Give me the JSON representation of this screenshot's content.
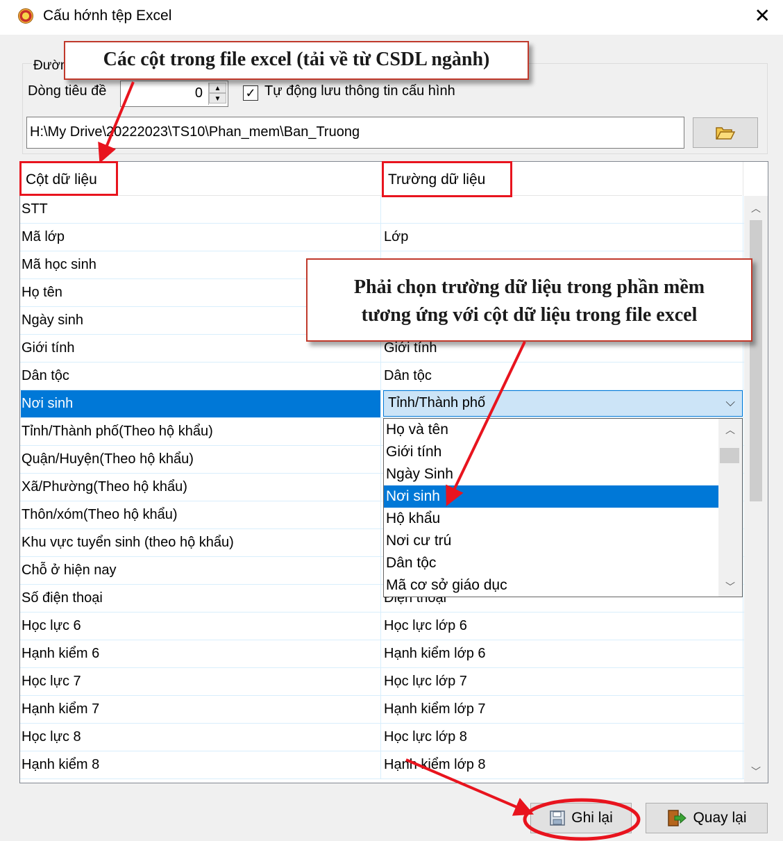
{
  "window": {
    "title": "Cấu hớnh tệp Excel",
    "close_glyph": "✕"
  },
  "config": {
    "path_group_label": "Đường",
    "header_row_label": "Dòng tiêu đề",
    "header_row_value": "0",
    "autosave_label": "Tự động lưu thông tin cấu hình",
    "autosave_checked": true,
    "file_path": "H:\\My Drive\\20222023\\TS10\\Phan_mem\\Ban_Truong"
  },
  "grid": {
    "columns": [
      "Cột dữ liệu",
      "Trường dữ liệu"
    ],
    "rows": [
      {
        "excel": "STT",
        "field": ""
      },
      {
        "excel": "Mã lớp",
        "field": "Lớp"
      },
      {
        "excel": "Mã học sinh",
        "field": ""
      },
      {
        "excel": "Họ tên",
        "field": ""
      },
      {
        "excel": "Ngày sinh",
        "field": ""
      },
      {
        "excel": "Giới tính",
        "field": "Giới tính"
      },
      {
        "excel": "Dân tộc",
        "field": "Dân tộc"
      },
      {
        "excel": "Nơi sinh",
        "field": "Tỉnh/Thành phố"
      },
      {
        "excel": "Tỉnh/Thành phố(Theo hộ khẩu)",
        "field": ""
      },
      {
        "excel": "Quận/Huyện(Theo hộ khẩu)",
        "field": ""
      },
      {
        "excel": "Xã/Phường(Theo hộ khẩu)",
        "field": ""
      },
      {
        "excel": "Thôn/xóm(Theo hộ khẩu)",
        "field": ""
      },
      {
        "excel": "Khu vực tuyển sinh (theo hộ khẩu)",
        "field": ""
      },
      {
        "excel": "Chỗ ở hiện nay",
        "field": ""
      },
      {
        "excel": "Số điện thoại",
        "field": "Điện thoại"
      },
      {
        "excel": "Học lực 6",
        "field": "Học lực lớp 6"
      },
      {
        "excel": "Hạnh kiểm 6",
        "field": "Hạnh kiểm lớp 6"
      },
      {
        "excel": "Học lực 7",
        "field": "Học lực lớp 7"
      },
      {
        "excel": "Hạnh kiểm 7",
        "field": "Hạnh kiểm lớp 7"
      },
      {
        "excel": "Học lực 8",
        "field": "Học lực lớp 8"
      },
      {
        "excel": "Hạnh kiểm 8",
        "field": "Hạnh kiểm lớp 8"
      }
    ],
    "selected_row": 7
  },
  "dropdown": {
    "items": [
      "Họ và tên",
      "Giới tính",
      "Ngày Sinh",
      "Nơi sinh",
      "Hộ khẩu",
      "Nơi cư trú",
      "Dân tộc",
      "Mã cơ sở giáo dục"
    ],
    "selected_index": 3
  },
  "callouts": {
    "top": "Các cột trong file excel (tải về từ CSDL ngành)",
    "middle_line1": "Phải chọn trường dữ liệu trong phần mềm",
    "middle_line2": "tương ứng với cột dữ liệu trong file excel"
  },
  "buttons": {
    "save": "Ghi lại",
    "back": "Quay lại"
  },
  "icons": [
    "app-icon",
    "close-icon",
    "folder-open-icon",
    "spin-up-icon",
    "spin-down-icon",
    "chevron-down-icon",
    "floppy-disk-icon",
    "exit-door-icon"
  ],
  "colors": {
    "selection": "#0078d7",
    "annotation_red": "#e8141e",
    "combo_bg": "#cce4f7"
  }
}
